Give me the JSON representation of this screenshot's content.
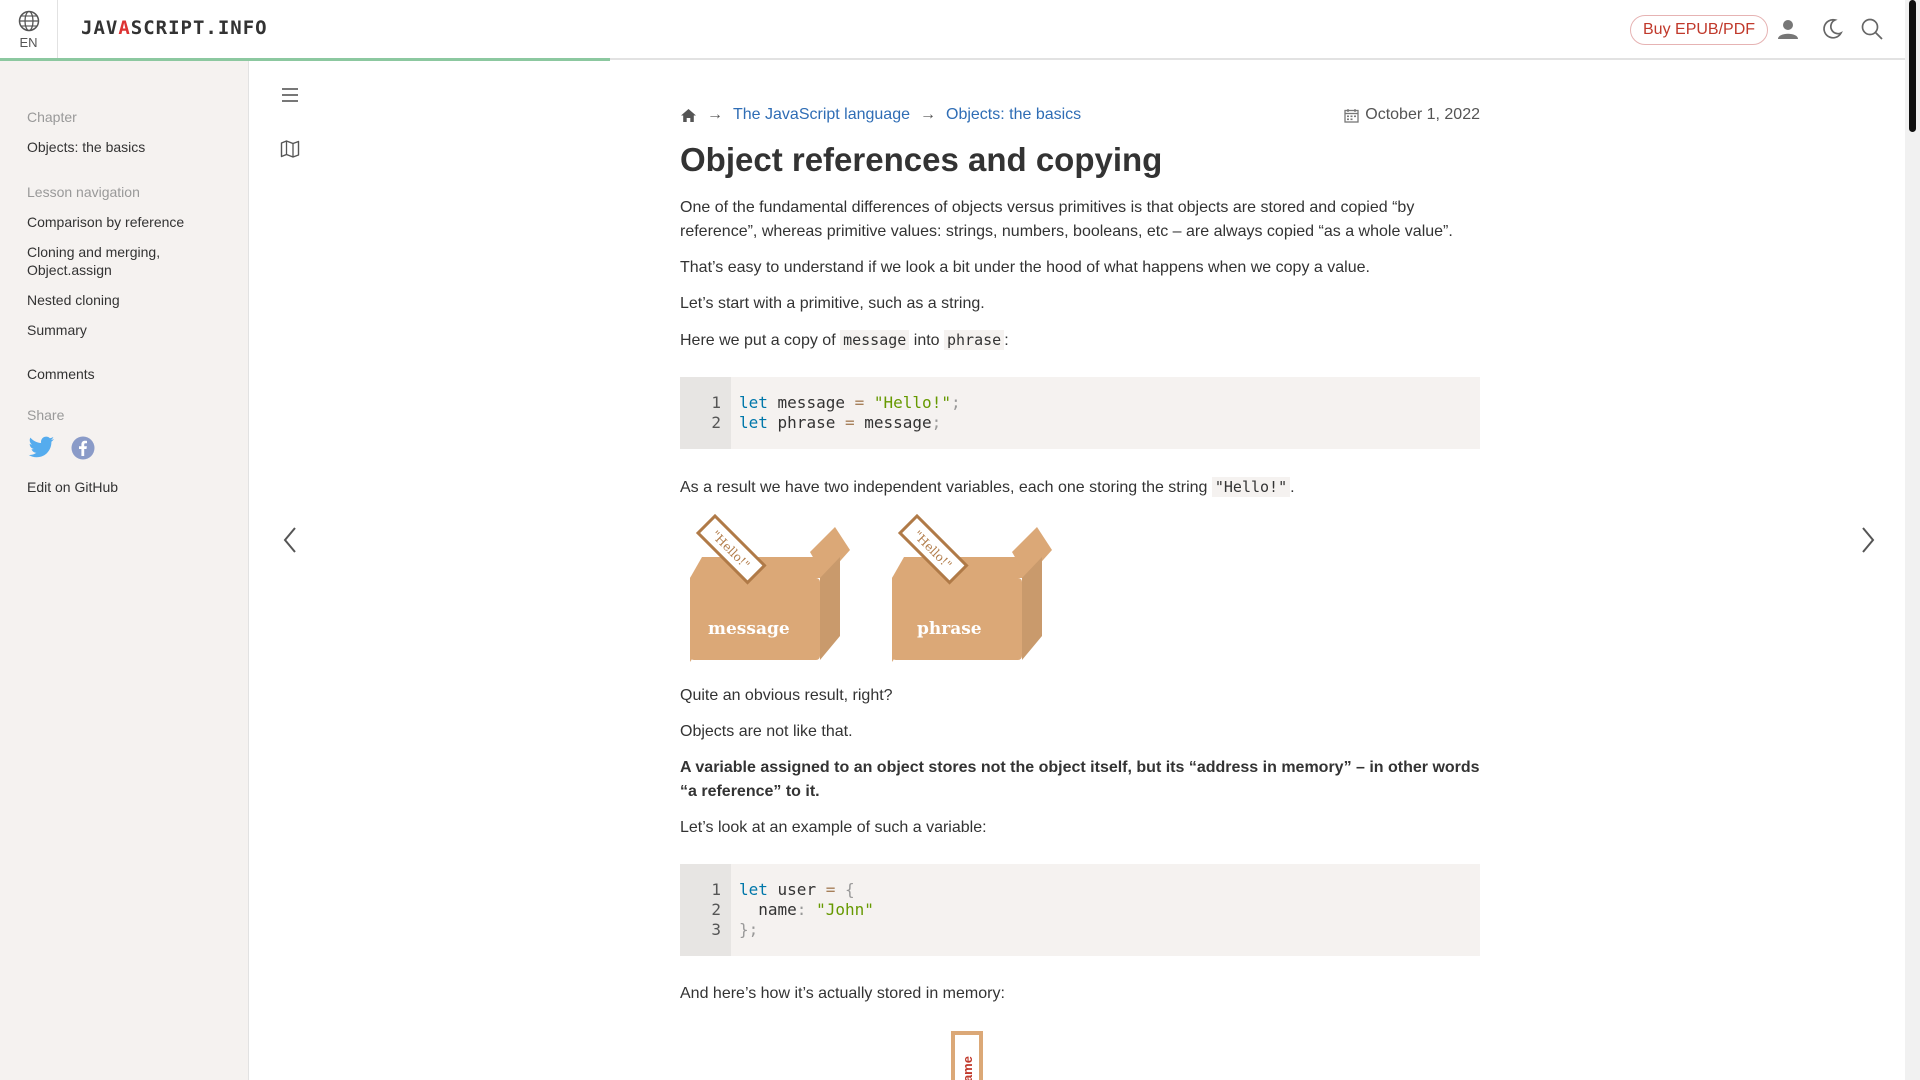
{
  "header": {
    "lang": "EN",
    "logo_before": "JAV",
    "logo_accent": "A",
    "logo_after": "SCRIPT.INFO",
    "buy_label": "Buy EPUB/PDF",
    "icons": [
      "globe-icon",
      "user-icon",
      "moon-icon",
      "search-icon"
    ]
  },
  "sidebar": {
    "chapter_heading": "Chapter",
    "chapter_link": "Objects: the basics",
    "nav_heading": "Lesson navigation",
    "items": [
      {
        "label": "Comparison by reference"
      },
      {
        "label": "Cloning and merging, Object.assign"
      },
      {
        "label": "Nested cloning"
      },
      {
        "label": "Summary"
      }
    ],
    "comments": "Comments",
    "share_heading": "Share",
    "edit": "Edit on GitHub"
  },
  "breadcrumb": {
    "items": [
      "The JavaScript language",
      "Objects: the basics"
    ],
    "separator": "→",
    "date": "October 1, 2022"
  },
  "article": {
    "title": "Object references and copying",
    "p1": "One of the fundamental differences of objects versus primitives is that objects are stored and copied “by reference”, whereas primitive values: strings, numbers, booleans, etc – are always copied “as a whole value”.",
    "p2": "That’s easy to understand if we look a bit under the hood of what happens when we copy a value.",
    "p3": "Let’s start with a primitive, such as a string.",
    "p4_a": "Here we put a copy of ",
    "p4_code1": "message",
    "p4_b": " into ",
    "p4_code2": "phrase",
    "p4_c": ":",
    "code1": {
      "numbers": [
        "1",
        "2"
      ],
      "line1": {
        "kw": "let",
        "name": " message ",
        "op": "=",
        "sp": " ",
        "str": "\"Hello!\"",
        "end": ";"
      },
      "line2": {
        "kw": "let",
        "name": " phrase ",
        "op": "=",
        "rest": " message",
        "end": ";"
      }
    },
    "p5_a": "As a result we have two independent variables, each one storing the string ",
    "p5_code": "\"Hello!\"",
    "p5_b": ".",
    "figure1": {
      "label_left": "message",
      "label_right": "phrase",
      "tag": "\"Hello!\""
    },
    "p6": "Quite an obvious result, right?",
    "p7": "Objects are not like that.",
    "p8": "A variable assigned to an object stores not the object itself, but its “address in memory” – in other words “a reference” to it.",
    "p9": "Let’s look at an example of such a variable:",
    "code2": {
      "numbers": [
        "1",
        "2",
        "3"
      ],
      "line1": {
        "kw": "let",
        "name": " user ",
        "op": "=",
        "sp": " ",
        "brace": "{"
      },
      "line2": {
        "indent": "  ",
        "prop": "name",
        "colon": ":",
        "sp": " ",
        "str": "\"John\""
      },
      "line3": {
        "brace": "}",
        "end": ";"
      }
    },
    "p10": "And here’s how it’s actually stored in memory:",
    "figure2": {
      "label": "name"
    }
  },
  "colors": {
    "accent_link": "#2f6db5",
    "box": "#dba877",
    "box_dark": "#c08b5c",
    "logo_accent": "#d33"
  }
}
